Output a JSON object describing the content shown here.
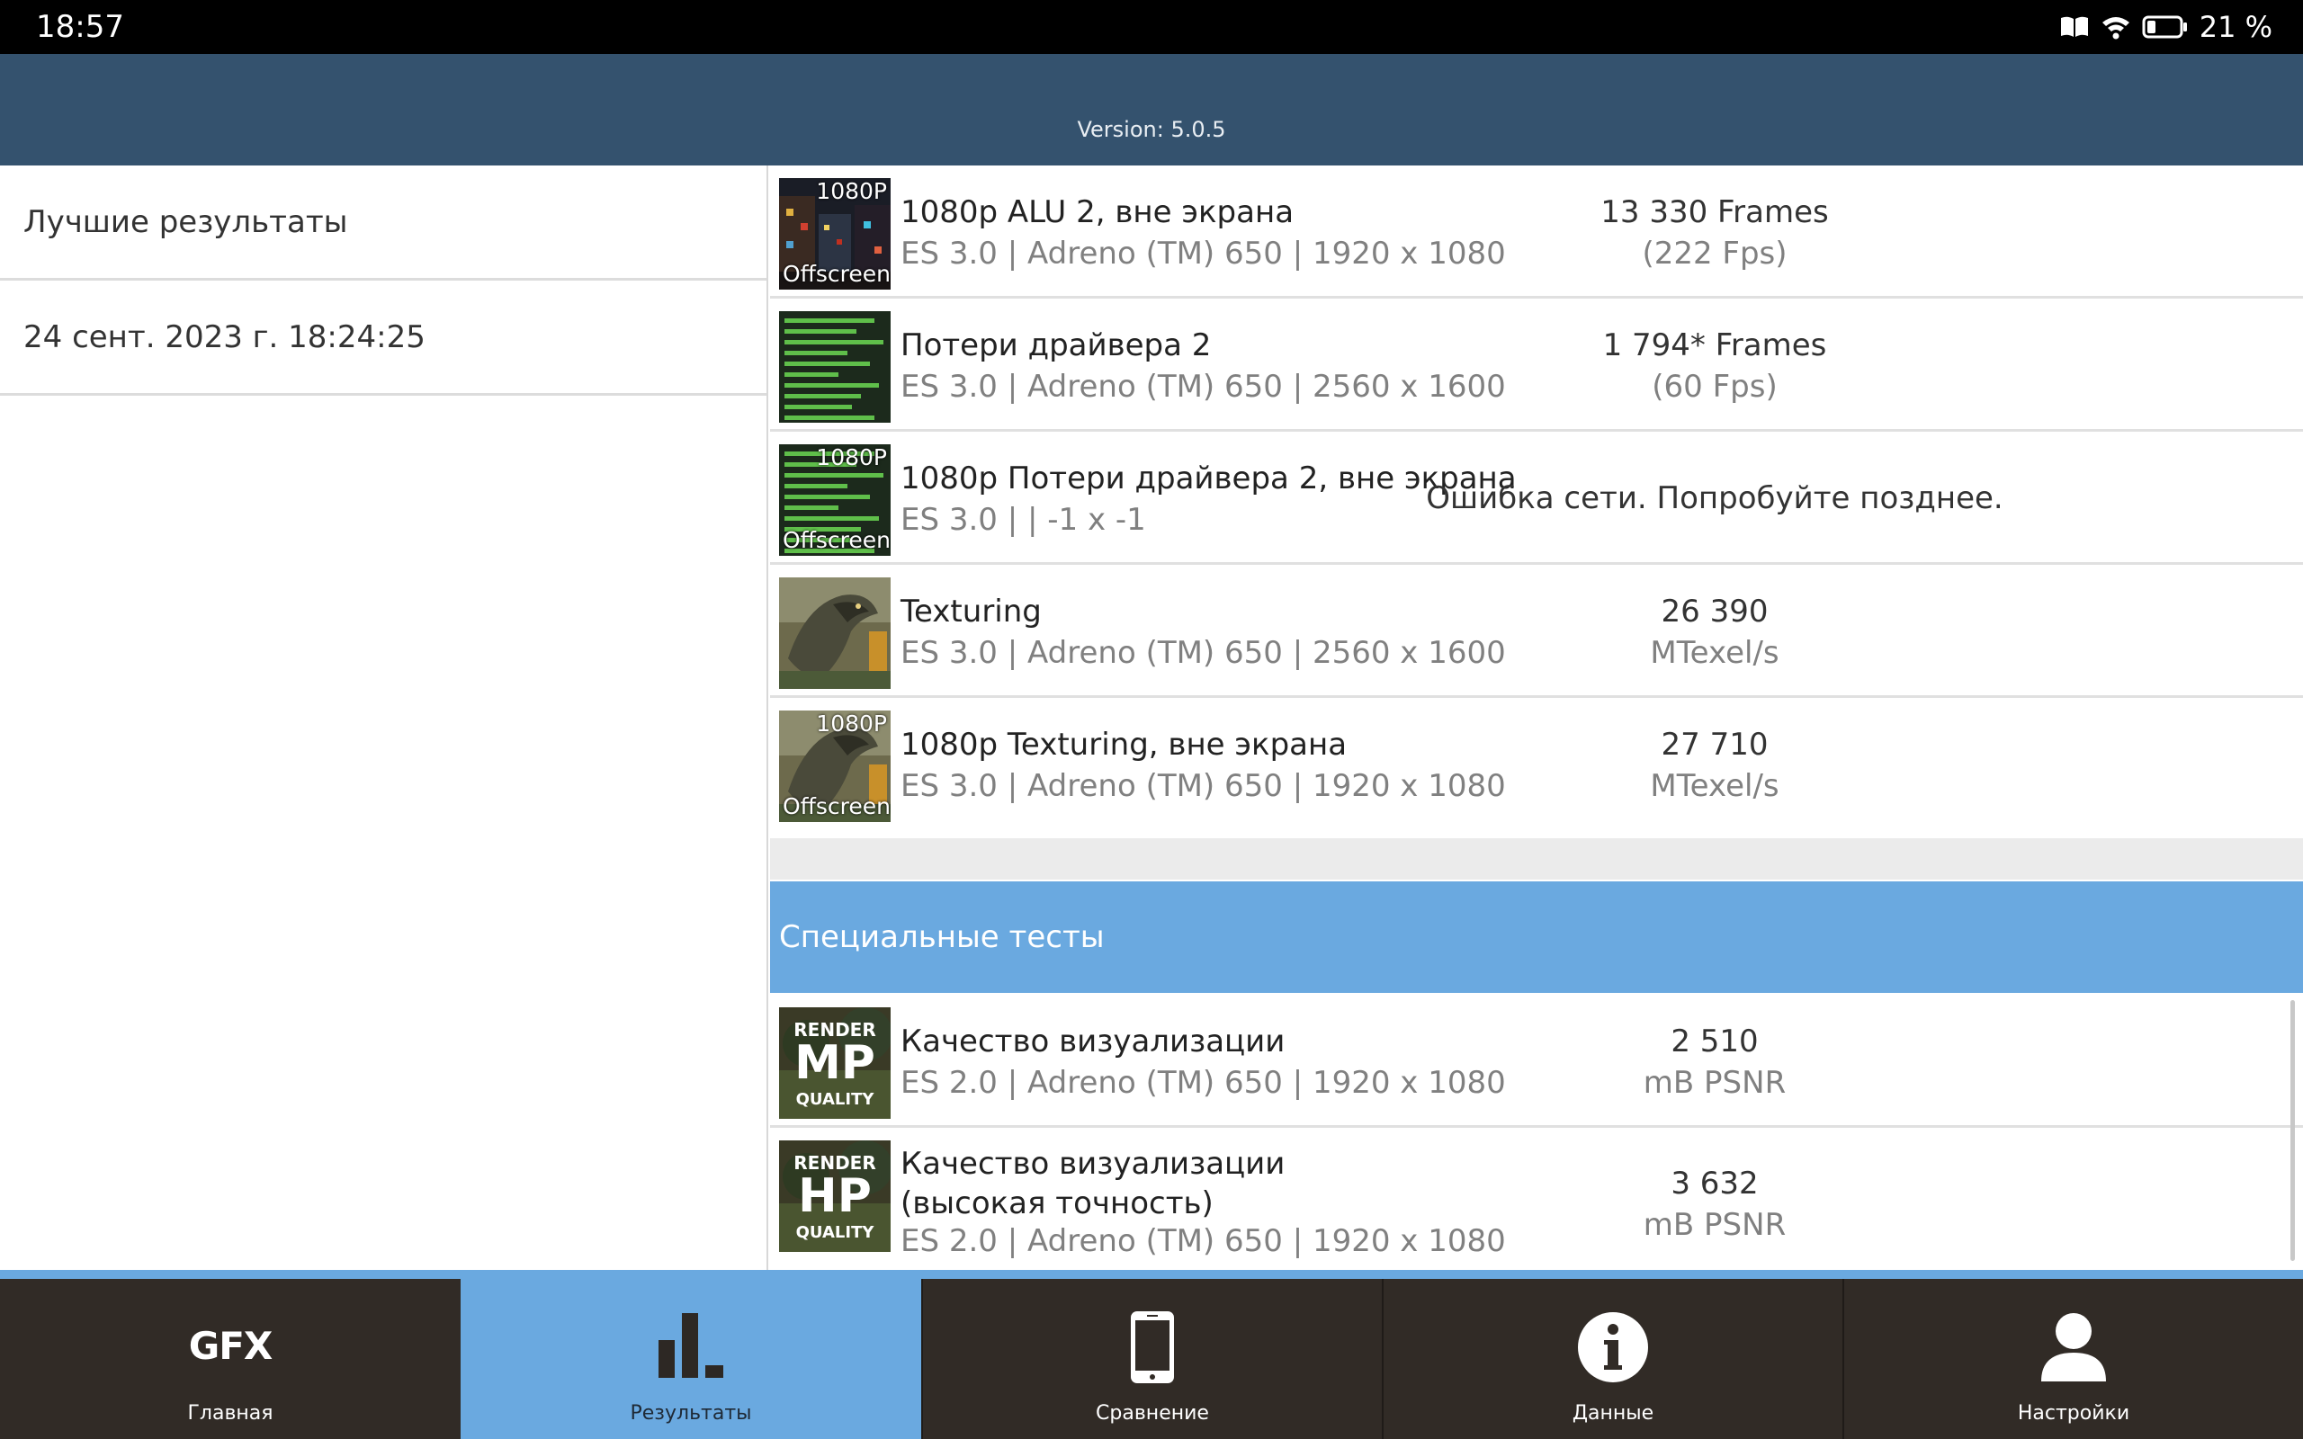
{
  "status_bar": {
    "time": "18:57",
    "battery_percent": "21 %"
  },
  "header": {
    "version": "Version: 5.0.5"
  },
  "left_panel": {
    "items": [
      {
        "label": "Лучшие результаты"
      },
      {
        "label": "24 сент. 2023 г. 18:24:25"
      }
    ]
  },
  "results": [
    {
      "thumb_top": "1080P",
      "thumb_bottom": "Offscreen",
      "title": "1080p ALU 2, вне экрана",
      "sub": "ES 3.0 | Adreno (TM) 650 | 1920 x 1080",
      "value": "13 330 Frames",
      "value_sub": "(222 Fps)"
    },
    {
      "thumb_top": "",
      "thumb_bottom": "",
      "title": "Потери драйвера 2",
      "sub": "ES 3.0 | Adreno (TM) 650 | 2560 x 1600",
      "value": "1 794* Frames",
      "value_sub": "(60 Fps)"
    },
    {
      "thumb_top": "1080P",
      "thumb_bottom": "Offscreen",
      "title": "1080p Потери драйвера 2, вне экрана",
      "sub": "ES 3.0 |  | -1 x -1",
      "error": "Ошибка сети. Попробуйте позднее."
    },
    {
      "thumb_top": "",
      "thumb_bottom": "",
      "title": "Texturing",
      "sub": "ES 3.0 | Adreno (TM) 650 | 2560 x 1600",
      "value": "26 390",
      "value_sub": "MTexel/s"
    },
    {
      "thumb_top": "1080P",
      "thumb_bottom": "Offscreen",
      "title": "1080p Texturing, вне экрана",
      "sub": "ES 3.0 | Adreno (TM) 650 | 1920 x 1080",
      "value": "27 710",
      "value_sub": "MTexel/s"
    }
  ],
  "special_section": {
    "title": "Специальные тесты"
  },
  "special_results": [
    {
      "thumb_top": "RENDER",
      "thumb_mid": "MP",
      "thumb_bottom": "QUALITY",
      "title": "Качество визуализации",
      "sub": "ES 2.0 | Adreno (TM) 650 | 1920 x 1080",
      "value": "2 510",
      "value_sub": "mB PSNR"
    },
    {
      "thumb_top": "RENDER",
      "thumb_mid": "HP",
      "thumb_bottom": "QUALITY",
      "title": "Качество визуализации (высокая точность)",
      "sub": "ES 2.0 | Adreno (TM) 650 | 1920 x 1080",
      "value": "3 632",
      "value_sub": "mB PSNR"
    }
  ],
  "bottom_nav": {
    "items": [
      {
        "label": "Главная",
        "icon": "gfx-logo-icon",
        "icon_text": "GFX"
      },
      {
        "label": "Результаты",
        "icon": "bar-chart-icon"
      },
      {
        "label": "Сравнение",
        "icon": "phone-icon"
      },
      {
        "label": "Данные",
        "icon": "info-icon"
      },
      {
        "label": "Настройки",
        "icon": "user-icon"
      }
    ],
    "active_index": 1
  },
  "colors": {
    "header": "#34526e",
    "accent": "#6aa9e0",
    "nav_background": "#312b26"
  }
}
